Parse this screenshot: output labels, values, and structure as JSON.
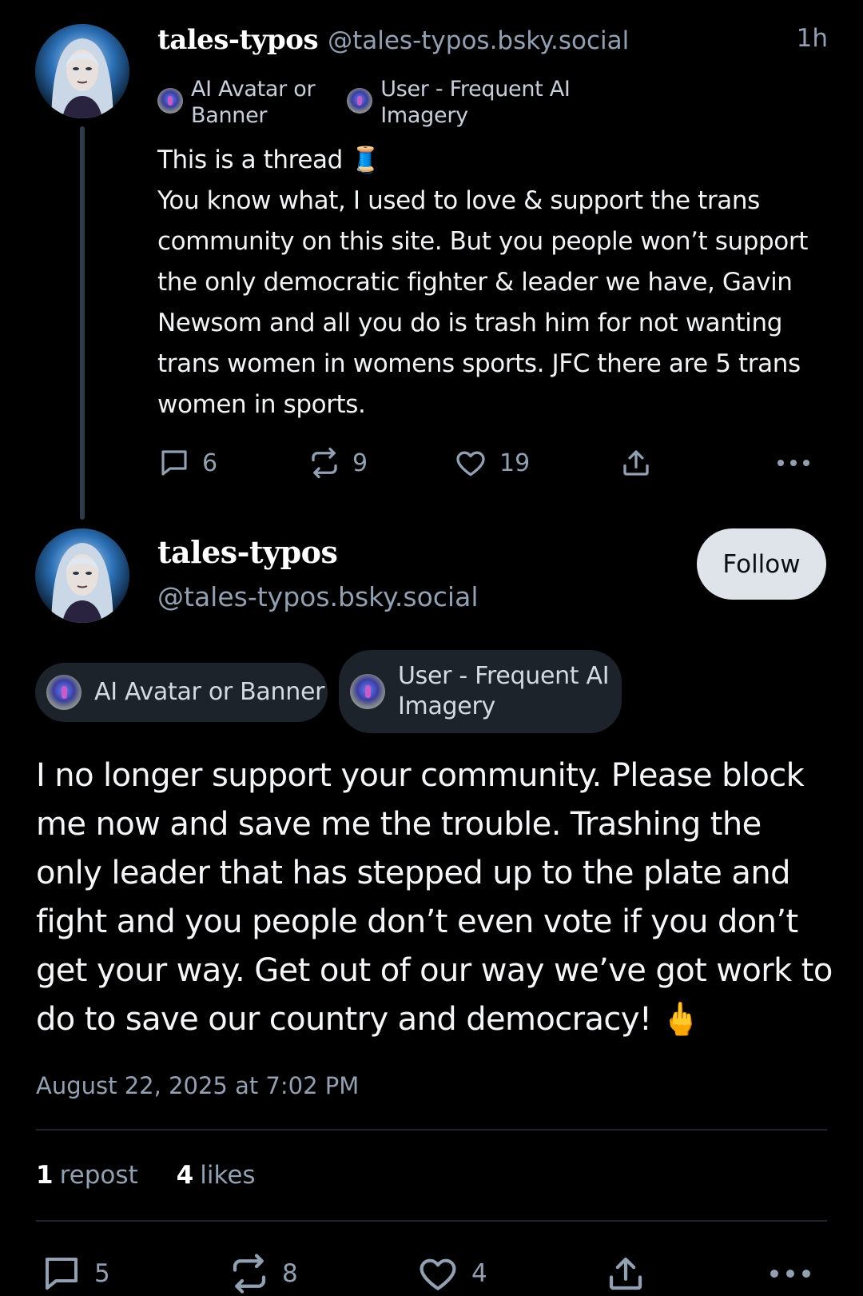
{
  "parent_post": {
    "author_name": "tales-typos",
    "author_handle": "@tales-typos.bsky.social",
    "time": "1h",
    "labels": [
      {
        "text": "AI Avatar or\nBanner"
      },
      {
        "text": "User - Frequent AI\nImagery"
      }
    ],
    "text": "This is a thread 🧵\nYou know what, I used to love & support the trans community on this site. But you people won’t support the only democratic fighter & leader we have, Gavin Newsom and all you do is trash him for not wanting trans women in womens sports. JFC there are 5 trans women in sports.",
    "actions": {
      "replies": "6",
      "reposts": "9",
      "likes": "19"
    }
  },
  "main_post": {
    "author_name": "tales-typos",
    "author_handle": "@tales-typos.bsky.social",
    "follow_label": "Follow",
    "labels": [
      {
        "text": "AI Avatar or Banner"
      },
      {
        "text": "User - Frequent AI\nImagery"
      }
    ],
    "text": "I no longer support your community. Please block me now and save me the trouble. Trashing the only leader that has stepped up to the plate and fight and you people don’t even vote if you don’t get your way. Get out of our way we’ve got work to do to save our country and democracy! 🖕",
    "timestamp": "August 22, 2025 at 7:02 PM",
    "stats": {
      "reposts_count": "1",
      "reposts_label": "repost",
      "likes_count": "4",
      "likes_label": "likes"
    },
    "actions": {
      "replies": "5",
      "reposts": "8",
      "likes": "4"
    }
  },
  "icons": [
    "avatar",
    "label-badge-icon",
    "reply-icon",
    "repost-icon",
    "like-icon",
    "share-icon",
    "more-icon"
  ],
  "colors": {
    "background": "#000000",
    "muted_text": "#93a0b2",
    "follow_button": "#dfe4ea",
    "pill_background": "#1d232b"
  }
}
